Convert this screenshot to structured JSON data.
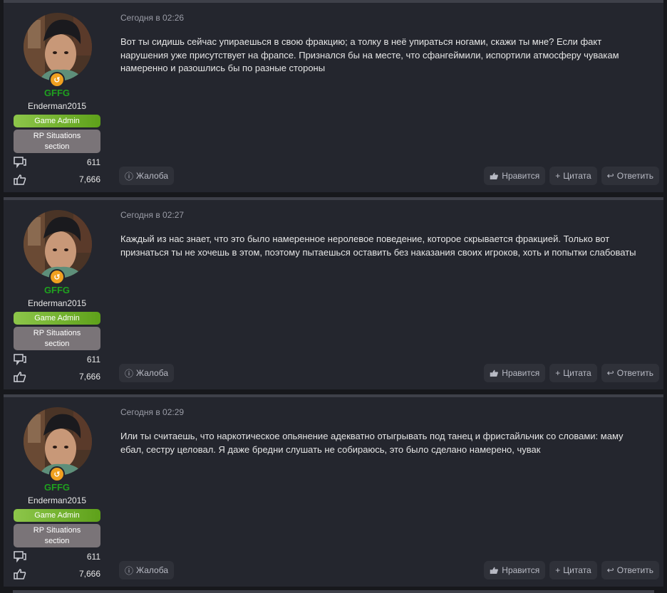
{
  "posts": [
    {
      "date": "Сегодня в 02:26",
      "body": "Вот ты сидишь сейчас упираешься в свою фракцию; а толку в неё упираться ногами, скажи ты мне? Если факт нарушения уже присутствует на фрапсе. Признался бы на месте, что сфангеймили, испортили атмосферу чувакам намеренно и разошлись бы по разные стороны"
    },
    {
      "date": "Сегодня в 02:27",
      "body": "Каждый из нас знает, что это было намеренное неролевое поведение, которое скрывается фракцией. Только вот признаться ты не хочешь в этом, поэтому пытаешься оставить без наказания своих игроков, хоть и попытки слабоваты"
    },
    {
      "date": "Сегодня в 02:29",
      "body": "Или ты считаешь, что наркотическое опьянение адекватно отыгрывать под танец и фристайльчик со словами: маму ебал, сестру целовал. Я даже бредни слушать не собираюсь, это было сделано намерено, чувак"
    }
  ],
  "user": {
    "title": "GFFG",
    "name": "Enderman2015",
    "badge_admin": "Game Admin",
    "badge_section_line1": "RP Situations",
    "badge_section_line2": "section",
    "messages": "611",
    "reactions": "7,666",
    "avatar_badge_glyph": "↺"
  },
  "actions": {
    "report": "Жалоба",
    "like": "Нравится",
    "quote": "Цитата",
    "reply": "Ответить"
  },
  "icons": {
    "report": "flag-icon",
    "like": "thumbs-up-icon",
    "quote": "plus-icon",
    "reply": "reply-icon",
    "messages": "chat-bubbles-icon",
    "reactions": "thumbs-up-icon"
  },
  "colors": {
    "background": "#17181c",
    "post_bg": "#24262e",
    "user_title": "#1fa11f",
    "admin_badge": "#6fb22a",
    "section_badge": "#7a7478"
  }
}
